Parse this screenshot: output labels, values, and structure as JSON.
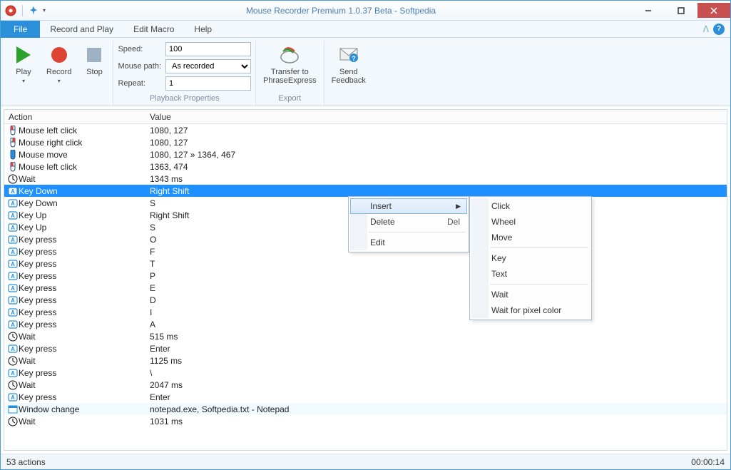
{
  "window": {
    "title": "Mouse Recorder Premium 1.0.37 Beta - Softpedia"
  },
  "menu": {
    "file": "File",
    "items": [
      "Record and Play",
      "Edit Macro",
      "Help"
    ]
  },
  "ribbon": {
    "play": "Play",
    "record": "Record",
    "stop": "Stop",
    "speed_label": "Speed:",
    "speed_value": "100",
    "path_label": "Mouse path:",
    "path_value": "As recorded",
    "repeat_label": "Repeat:",
    "repeat_value": "1",
    "group_playback": "Playback Properties",
    "transfer": "Transfer to\nPhraseExpress",
    "group_export": "Export",
    "feedback": "Send\nFeedback"
  },
  "columns": {
    "action": "Action",
    "value": "Value"
  },
  "rows": [
    {
      "icon": "mouse-left",
      "action": "Mouse left click",
      "value": "1080, 127"
    },
    {
      "icon": "mouse-right",
      "action": "Mouse right click",
      "value": "1080, 127"
    },
    {
      "icon": "mouse-move",
      "action": "Mouse move",
      "value": "1080, 127 » 1364, 467"
    },
    {
      "icon": "mouse-left",
      "action": "Mouse left click",
      "value": "1363, 474"
    },
    {
      "icon": "wait",
      "action": "Wait",
      "value": "1343 ms"
    },
    {
      "icon": "key",
      "action": "Key Down",
      "value": "Right Shift",
      "selected": true
    },
    {
      "icon": "key",
      "action": "Key Down",
      "value": "S"
    },
    {
      "icon": "key",
      "action": "Key Up",
      "value": "Right Shift"
    },
    {
      "icon": "key",
      "action": "Key Up",
      "value": "S"
    },
    {
      "icon": "key",
      "action": "Key press",
      "value": "O"
    },
    {
      "icon": "key",
      "action": "Key press",
      "value": "F"
    },
    {
      "icon": "key",
      "action": "Key press",
      "value": "T"
    },
    {
      "icon": "key",
      "action": "Key press",
      "value": "P"
    },
    {
      "icon": "key",
      "action": "Key press",
      "value": "E"
    },
    {
      "icon": "key",
      "action": "Key press",
      "value": "D"
    },
    {
      "icon": "key",
      "action": "Key press",
      "value": "I"
    },
    {
      "icon": "key",
      "action": "Key press",
      "value": "A"
    },
    {
      "icon": "wait",
      "action": "Wait",
      "value": "515 ms"
    },
    {
      "icon": "key",
      "action": "Key press",
      "value": "Enter"
    },
    {
      "icon": "wait",
      "action": "Wait",
      "value": "1125 ms"
    },
    {
      "icon": "key",
      "action": "Key press",
      "value": "\\"
    },
    {
      "icon": "wait",
      "action": "Wait",
      "value": "2047 ms"
    },
    {
      "icon": "key",
      "action": "Key press",
      "value": "Enter"
    },
    {
      "icon": "window",
      "action": "Window change",
      "value": "notepad.exe, Softpedia.txt - Notepad",
      "alt": true
    },
    {
      "icon": "wait",
      "action": "Wait",
      "value": "1031 ms"
    }
  ],
  "status": {
    "count": "53 actions",
    "time": "00:00:14"
  },
  "ctx1": {
    "insert": "Insert",
    "delete": "Delete",
    "delete_sc": "Del",
    "edit": "Edit"
  },
  "ctx2": {
    "click": "Click",
    "wheel": "Wheel",
    "move": "Move",
    "key": "Key",
    "text": "Text",
    "wait": "Wait",
    "pixel": "Wait for pixel color"
  }
}
